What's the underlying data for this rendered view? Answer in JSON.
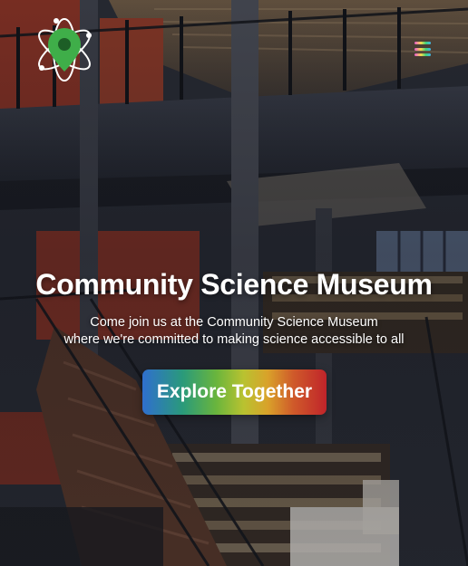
{
  "header": {
    "logo_icon": "atom-location-pin-icon",
    "menu_icon": "hamburger-menu-icon"
  },
  "hero": {
    "title": "Community Science Museum",
    "subtitle_line1": "Come join us at the Community Science Museum",
    "subtitle_line2": "where we're committed to making science accessible to all",
    "cta_label": "Explore Together"
  },
  "colors": {
    "logo_green": "#3fae49",
    "cta_gradient": [
      "#2f6fcf",
      "#69b53d",
      "#d9a22a",
      "#c0242a"
    ]
  }
}
